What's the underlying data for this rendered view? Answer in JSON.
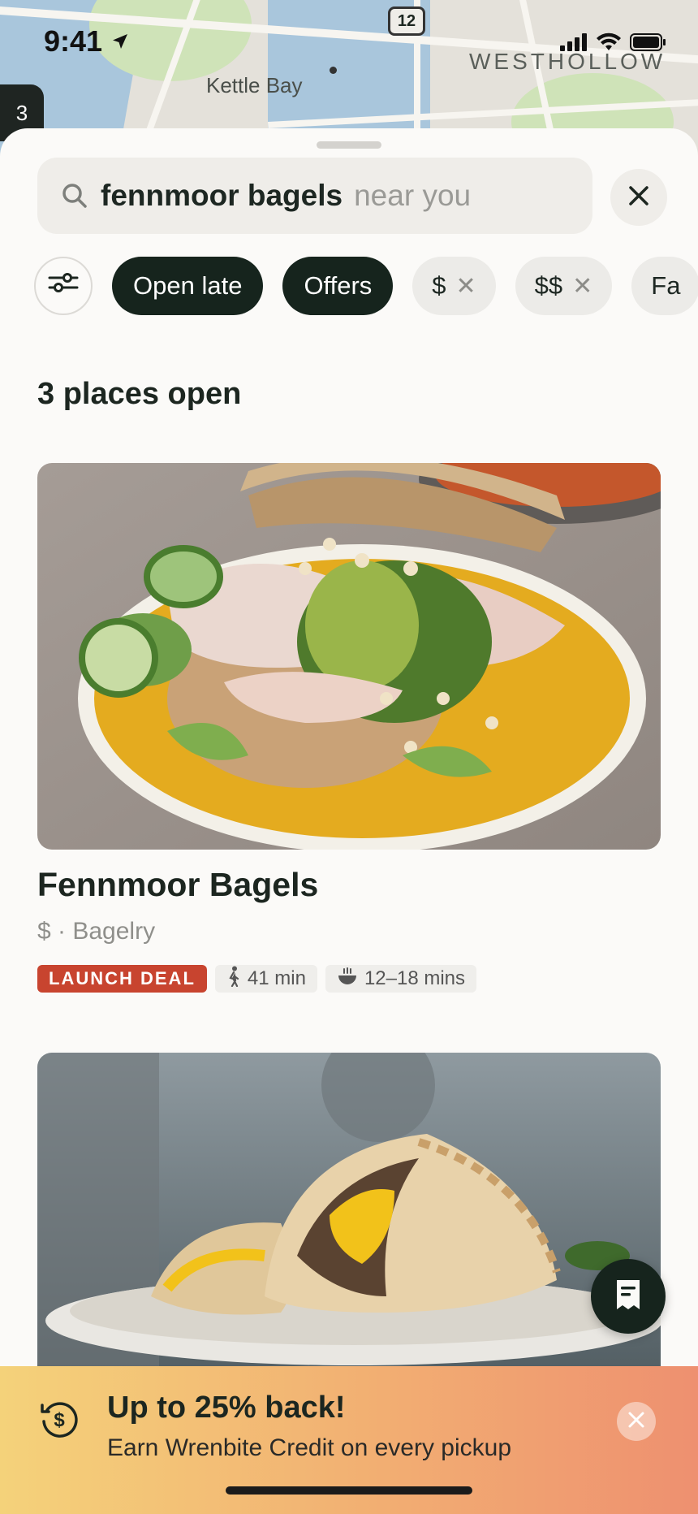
{
  "status": {
    "time": "9:41"
  },
  "map": {
    "place_label": "Kettle Bay",
    "brand_label": "WESTHOLLOW",
    "route_shield": "12",
    "side_tab": "3"
  },
  "search": {
    "query": "fennmoor bagels",
    "hint": "near you"
  },
  "chips": [
    {
      "label": "Open late",
      "active": true
    },
    {
      "label": "Offers",
      "active": true
    },
    {
      "label": "$",
      "active": false
    },
    {
      "label": "$$",
      "active": false
    },
    {
      "label": "Fa",
      "active": false
    }
  ],
  "results": {
    "count_label": "3 places open"
  },
  "cards": [
    {
      "title": "Fennmoor Bagels",
      "subtitle": "$ · Bagelry",
      "deal": "LAUNCH DEAL",
      "walk": "41 min",
      "prep": "12–18 mins"
    }
  ],
  "promo": {
    "title": "Up to 25% back!",
    "subtitle": "Earn Wrenbite Credit on every pickup"
  },
  "colors": {
    "accent_dark": "#16241d",
    "deal_red": "#c8442f",
    "promo_start": "#f4d27a",
    "promo_end": "#ee9070"
  }
}
